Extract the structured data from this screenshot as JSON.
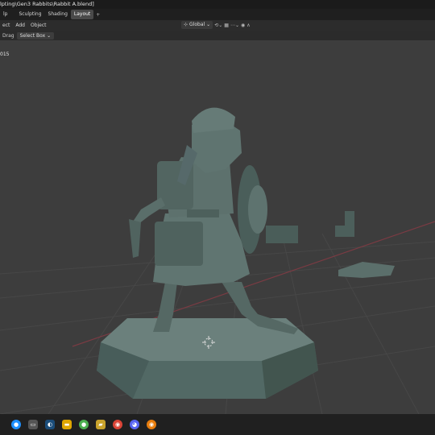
{
  "window": {
    "title": "lpting\\Gen3 Rabbits\\Rabbit A.blend]"
  },
  "topbar": {
    "menu_first": "lp",
    "tabs": [
      {
        "label": "Sculpting"
      },
      {
        "label": "Shading"
      },
      {
        "label": "Layout"
      }
    ],
    "add_tab": "+"
  },
  "header": {
    "items": [
      "ect",
      "Add",
      "Object"
    ],
    "transform_orientation": "Global"
  },
  "tool_settings": {
    "drag_label": "Drag",
    "select_mode": "Select Box"
  },
  "viewport": {
    "frame_label": "015"
  },
  "colors": {
    "model": "#5a6e6a",
    "grid": "#474747",
    "x_axis": "#7a3b43"
  },
  "taskbar": {
    "icons": [
      "windows-icon",
      "edge-icon",
      "files-icon",
      "steam-icon",
      "explorer-icon",
      "app-icon",
      "chrome-icon",
      "discord-icon",
      "blender-icon"
    ]
  }
}
